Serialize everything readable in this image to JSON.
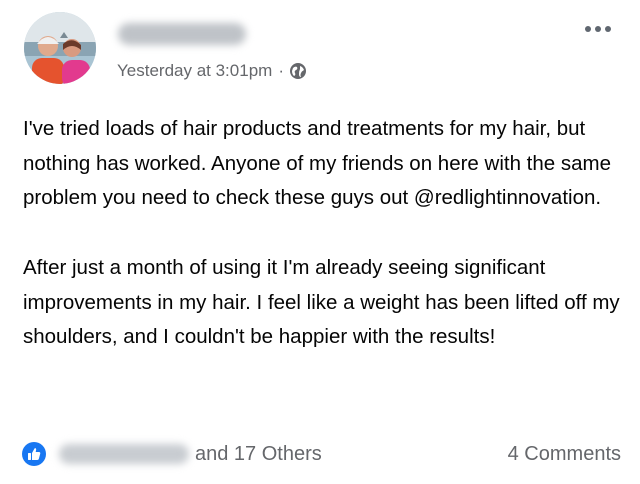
{
  "post": {
    "author_name": "Sam Prince",
    "timestamp": "Yesterday at 3:01pm",
    "separator": "·",
    "privacy_icon": "globe-icon",
    "more_icon": "more-options-icon",
    "paragraphs": [
      "I've tried loads of hair products and treatments for my hair, but nothing has worked. Anyone of my friends on here with the same problem you need to check these guys out @redlightinnovation.",
      "After just a month of using it I'm already seeing significant improvements in my hair. I feel like a weight has been lifted off my shoulders, and I couldn't be happier with the results!"
    ]
  },
  "reactions": {
    "icon": "like-icon",
    "liker_name": "Sammy Davis",
    "others_text": "and 17 Others",
    "comments_text": "4 Comments"
  },
  "colors": {
    "like_blue": "#1877f2",
    "meta_gray": "#65676b"
  }
}
